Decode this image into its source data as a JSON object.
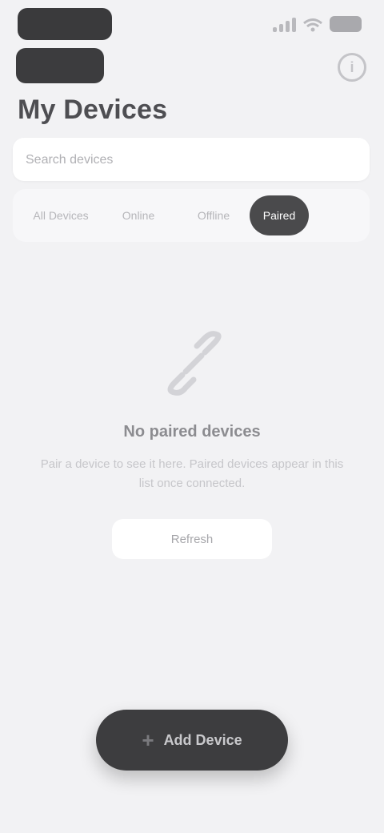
{
  "status_bar": {
    "time": "",
    "icons": [
      "signal-icon",
      "wifi-icon",
      "battery-icon"
    ]
  },
  "header": {
    "back_label": "",
    "title": "My Devices",
    "info_icon": "info-icon"
  },
  "search": {
    "placeholder": "Search devices",
    "value": ""
  },
  "tabs": [
    {
      "label": "All Devices",
      "active": false
    },
    {
      "label": "Online",
      "active": false
    },
    {
      "label": "Offline",
      "active": false
    },
    {
      "label": "Paired",
      "active": true
    }
  ],
  "empty_state": {
    "icon": "link-icon",
    "title": "No paired devices",
    "description": "Pair a device to see it here. Paired devices appear in this list once connected.",
    "button_label": "Refresh"
  },
  "primary_action": {
    "icon": "plus-icon",
    "label": "Add Device"
  },
  "colors": {
    "background": "#f2f2f4",
    "dark": "#3d3d3f",
    "surface": "#ffffff"
  }
}
